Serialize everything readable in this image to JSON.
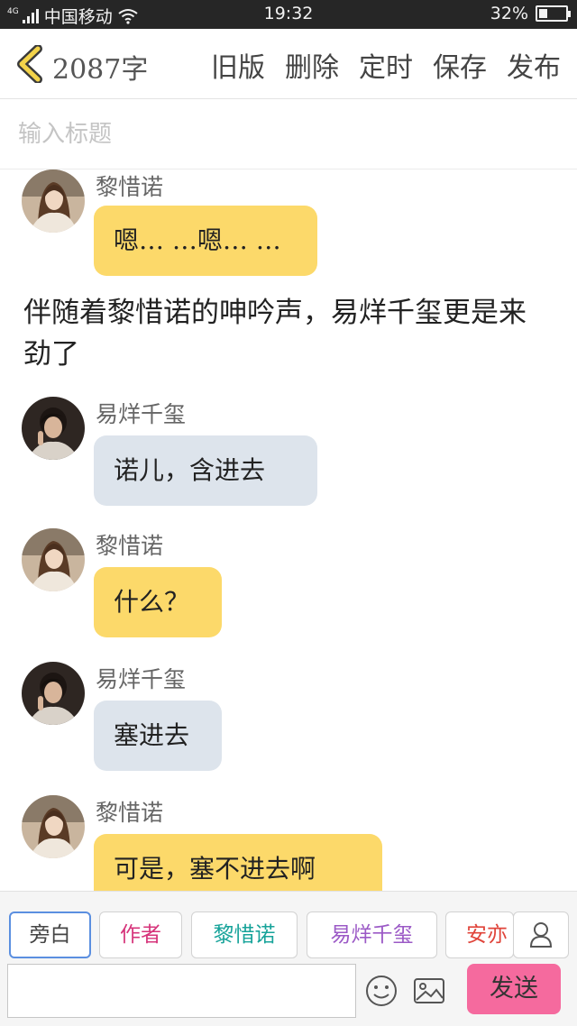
{
  "status_bar": {
    "network": "4G",
    "carrier": "中国移动",
    "time": "19:32",
    "battery_text": "32%",
    "battery_level": 0.32
  },
  "header": {
    "char_count": "2087字",
    "actions": [
      "旧版",
      "删除",
      "定时",
      "保存",
      "发布"
    ]
  },
  "title_input": {
    "placeholder": "输入标题",
    "value": ""
  },
  "chat": {
    "messages": [
      {
        "speaker": "黎惜诺",
        "text": "嗯… …嗯… …",
        "style": "yellow"
      },
      {
        "narration": "伴随着黎惜诺的呻吟声，易烊千玺更是来劲了"
      },
      {
        "speaker": "易烊千玺",
        "text": "诺儿，含进去",
        "style": "gray"
      },
      {
        "speaker": "黎惜诺",
        "text": "什么？",
        "style": "yellow"
      },
      {
        "speaker": "易烊千玺",
        "text": "塞进去",
        "style": "gray"
      },
      {
        "speaker": "黎惜诺",
        "text": "可是，塞不进去啊",
        "style": "yellow"
      }
    ]
  },
  "roles": [
    {
      "label": "旁白",
      "color": "#444444"
    },
    {
      "label": "作者",
      "color": "#d6337a"
    },
    {
      "label": "黎惜诺",
      "color": "#17a39a"
    },
    {
      "label": "易烊千玺",
      "color": "#9b59c6"
    },
    {
      "label": "安亦",
      "color": "#e0443a"
    }
  ],
  "composer": {
    "placeholder": "",
    "value": "",
    "send_label": "发送"
  },
  "colors": {
    "bubble_female": "#fcd96a",
    "bubble_male": "#dde4ec",
    "send_button": "#f56a9e",
    "active_role_border": "#5b8fe0"
  },
  "icons": [
    "back-chevron-icon",
    "signal-icon",
    "wifi-icon",
    "battery-icon",
    "person-icon",
    "emoji-icon",
    "image-icon"
  ]
}
